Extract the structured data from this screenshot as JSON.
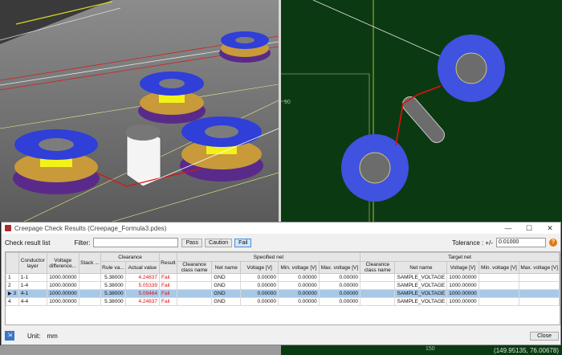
{
  "dialog": {
    "title": "Creepage Check Results (Creepage_Formula3.pdes)",
    "check_result_list_label": "Check result list",
    "filter_label": "Filter:",
    "filter_value": "",
    "pass_label": "Pass",
    "caution_label": "Caution",
    "fail_label": "Fail",
    "tolerance_label": "Tolerance : +/-",
    "tolerance_value": "0.01000",
    "unit_label": "Unit:",
    "unit_value": "mm",
    "close_label": "Close"
  },
  "table": {
    "group_headers": {
      "clearance": "Clearance",
      "specified": "Specified net",
      "target": "Target net"
    },
    "headers": {
      "conductor_layer": "Conductor layer",
      "voltage_diff": "Voltage difference...",
      "stack": "Stack ...",
      "rule_value": "Rule va...",
      "actual_value": "Actual value",
      "result": "Result",
      "clearance_class": "Clearance class name",
      "net_name": "Net name",
      "voltage": "Voltage [V]",
      "min_voltage": "Min. voltage [V]",
      "max_voltage": "Max. voltage [V]",
      "t_clearance_class": "Clearance class name",
      "t_net_name": "Net name",
      "t_voltage": "Voltage [V]",
      "t_min_voltage": "Min. voltage [V]",
      "t_max_voltage": "Max. voltage [V]"
    },
    "rows": [
      {
        "idx": "1",
        "layer": "1-1",
        "vdiff": "1000.00000",
        "stack": "",
        "rule": "5.38000",
        "actual": "4.24837",
        "result": "Fail",
        "cls": "",
        "net": "GND",
        "v": "0.00000",
        "vmin": "0.00000",
        "vmax": "0.00000",
        "tcls": "",
        "tnet": "SAMPLE_VOLTAGE",
        "tv": "1000.00000",
        "tvmin": "",
        "tvmax": ""
      },
      {
        "idx": "2",
        "layer": "1-4",
        "vdiff": "1000.00000",
        "stack": "",
        "rule": "5.38000",
        "actual": "5.05339",
        "result": "Fail",
        "cls": "",
        "net": "GND",
        "v": "0.00000",
        "vmin": "0.00000",
        "vmax": "0.00000",
        "tcls": "",
        "tnet": "SAMPLE_VOLTAGE",
        "tv": "1000.00000",
        "tvmin": "",
        "tvmax": ""
      },
      {
        "idx": "3",
        "layer": "4-1",
        "vdiff": "1000.00000",
        "stack": "",
        "rule": "5.38000",
        "actual": "5.09464",
        "result": "Fail",
        "cls": "",
        "net": "GND",
        "v": "0.00000",
        "vmin": "0.00000",
        "vmax": "0.00000",
        "tcls": "",
        "tnet": "SAMPLE_VOLTAGE",
        "tv": "1000.00000",
        "tvmin": "",
        "tvmax": ""
      },
      {
        "idx": "4",
        "layer": "4-4",
        "vdiff": "1000.00000",
        "stack": "",
        "rule": "5.38000",
        "actual": "4.24837",
        "result": "Fail",
        "cls": "",
        "net": "GND",
        "v": "0.00000",
        "vmin": "0.00000",
        "vmax": "0.00000",
        "tcls": "",
        "tnet": "SAMPLE_VOLTAGE",
        "tv": "1000.00000",
        "tvmin": "",
        "tvmax": ""
      }
    ]
  },
  "view2d": {
    "ruler_left": "90",
    "ruler_bottom": "150",
    "coordinates": "(149.95135, 76.00678)"
  },
  "colors": {
    "pad_blue": "#2f3fd8",
    "pad_gold": "#c89a3a",
    "drill_yellow": "#f2f21a",
    "board_green": "#0b3a12",
    "fail_red": "#d11111"
  }
}
